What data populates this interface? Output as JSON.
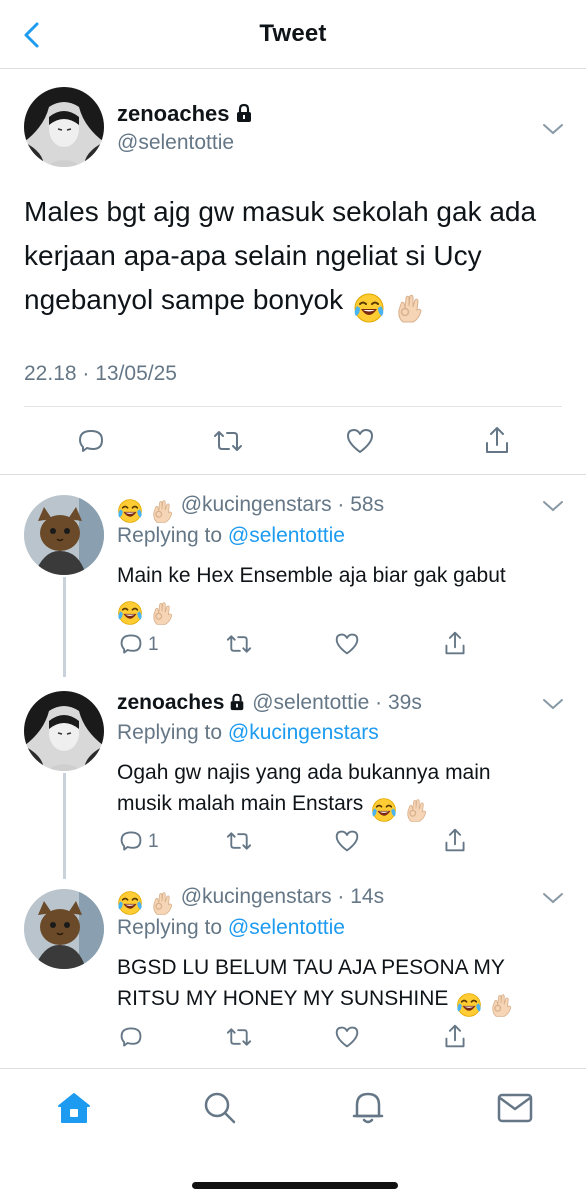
{
  "header": {
    "title": "Tweet",
    "back_icon": "back-chevron-icon"
  },
  "colors": {
    "accent": "#1d9bf0",
    "secondary_text": "#657786",
    "primary_text": "#0f1419",
    "divider": "#dcdfe2"
  },
  "main_tweet": {
    "display_name": "zenoaches",
    "handle": "@selentottie",
    "text": "Males bgt ajg gw masuk sekolah gak ada kerjaan apa-apa selain ngeliat si Ucy ngebanyol sampe bonyok",
    "emojis": [
      "face-with-tears-of-joy",
      "ok-hand"
    ],
    "timestamp": "22.18 · 13/05/25"
  },
  "replies": [
    {
      "display_name": "",
      "name_emojis": [
        "face-with-tears-of-joy",
        "ok-hand"
      ],
      "handle": "@kucingenstars",
      "time": "· 58s",
      "replying_prefix": "Replying to",
      "replying_to": "@selentottie",
      "text_line1": "Main ke Hex Ensemble aja biar gak gabut",
      "text_line2": "",
      "reply_count": "1"
    },
    {
      "display_name": "zenoaches",
      "handle": "@selentottie",
      "time": "· 39s",
      "replying_prefix": "Replying to",
      "replying_to": "@kucingenstars",
      "text_line1": "Ogah gw najis yang ada bukannya main",
      "text_line2": "musik malah main Enstars",
      "reply_count": "1"
    },
    {
      "display_name": "",
      "name_emojis": [
        "face-with-tears-of-joy",
        "ok-hand"
      ],
      "handle": "@kucingenstars",
      "time": "· 14s",
      "replying_prefix": "Replying to",
      "replying_to": "@selentottie",
      "text_line1": "BGSD LU BELUM TAU AJA PESONA MY",
      "text_line2": "RITSU MY HONEY MY SUNSHINE",
      "reply_count": ""
    }
  ],
  "tabbar": {
    "tabs": [
      "home-icon",
      "search-icon",
      "notifications-icon",
      "messages-icon"
    ],
    "active": "home-icon"
  }
}
